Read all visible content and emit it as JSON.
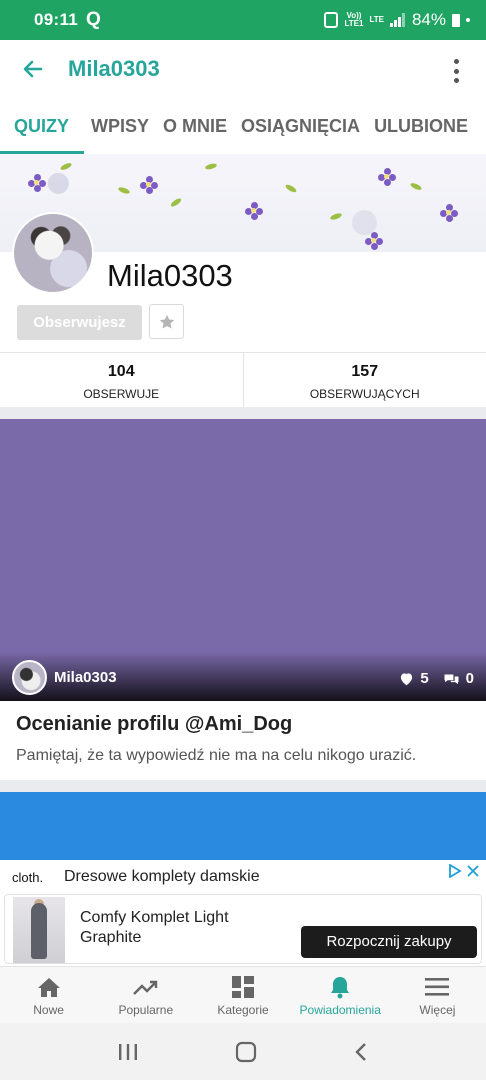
{
  "status_bar": {
    "time": "09:11",
    "app_icon": "Q",
    "volte_top": "Vo))",
    "volte_bottom": "LTE1",
    "lte": "LTE",
    "battery": "84%"
  },
  "appbar": {
    "title": "Mila0303"
  },
  "tabs": [
    {
      "label": "QUIZY",
      "active": true
    },
    {
      "label": "WPISY"
    },
    {
      "label": "O MNIE"
    },
    {
      "label": "OSIĄGNIĘCIA"
    },
    {
      "label": "ULUBIONE"
    }
  ],
  "profile": {
    "name": "Mila0303",
    "follow_label": "Obserwujesz",
    "stats": [
      {
        "value": "104",
        "label": "OBSERWUJE"
      },
      {
        "value": "157",
        "label": "OBSERWUJĄCYCH"
      }
    ]
  },
  "card": {
    "author": "Mila0303",
    "likes": "5",
    "comments": "0",
    "title": "Ocenianie profilu @Ami_Dog",
    "description": "Pamiętaj, że ta wypowiedź nie ma na celu nikogo urazić.",
    "image_color": "#7b6aaa"
  },
  "ad": {
    "logo": "cloth.",
    "headline": "Dresowe komplety damskie",
    "product": "Comfy Komplet Light Graphite",
    "cta": "Rozpocznij zakupy"
  },
  "bottom_nav": [
    {
      "label": "Nowe",
      "icon": "home-icon"
    },
    {
      "label": "Popularne",
      "icon": "trending-icon"
    },
    {
      "label": "Kategorie",
      "icon": "grid-icon"
    },
    {
      "label": "Powiadomienia",
      "icon": "bell-icon",
      "active": true
    },
    {
      "label": "Więcej",
      "icon": "menu-icon"
    }
  ],
  "colors": {
    "accent": "#26a69a",
    "status_bar": "#1fa463",
    "card_image": "#7b6aaa",
    "card2": "#2a8ae0"
  }
}
